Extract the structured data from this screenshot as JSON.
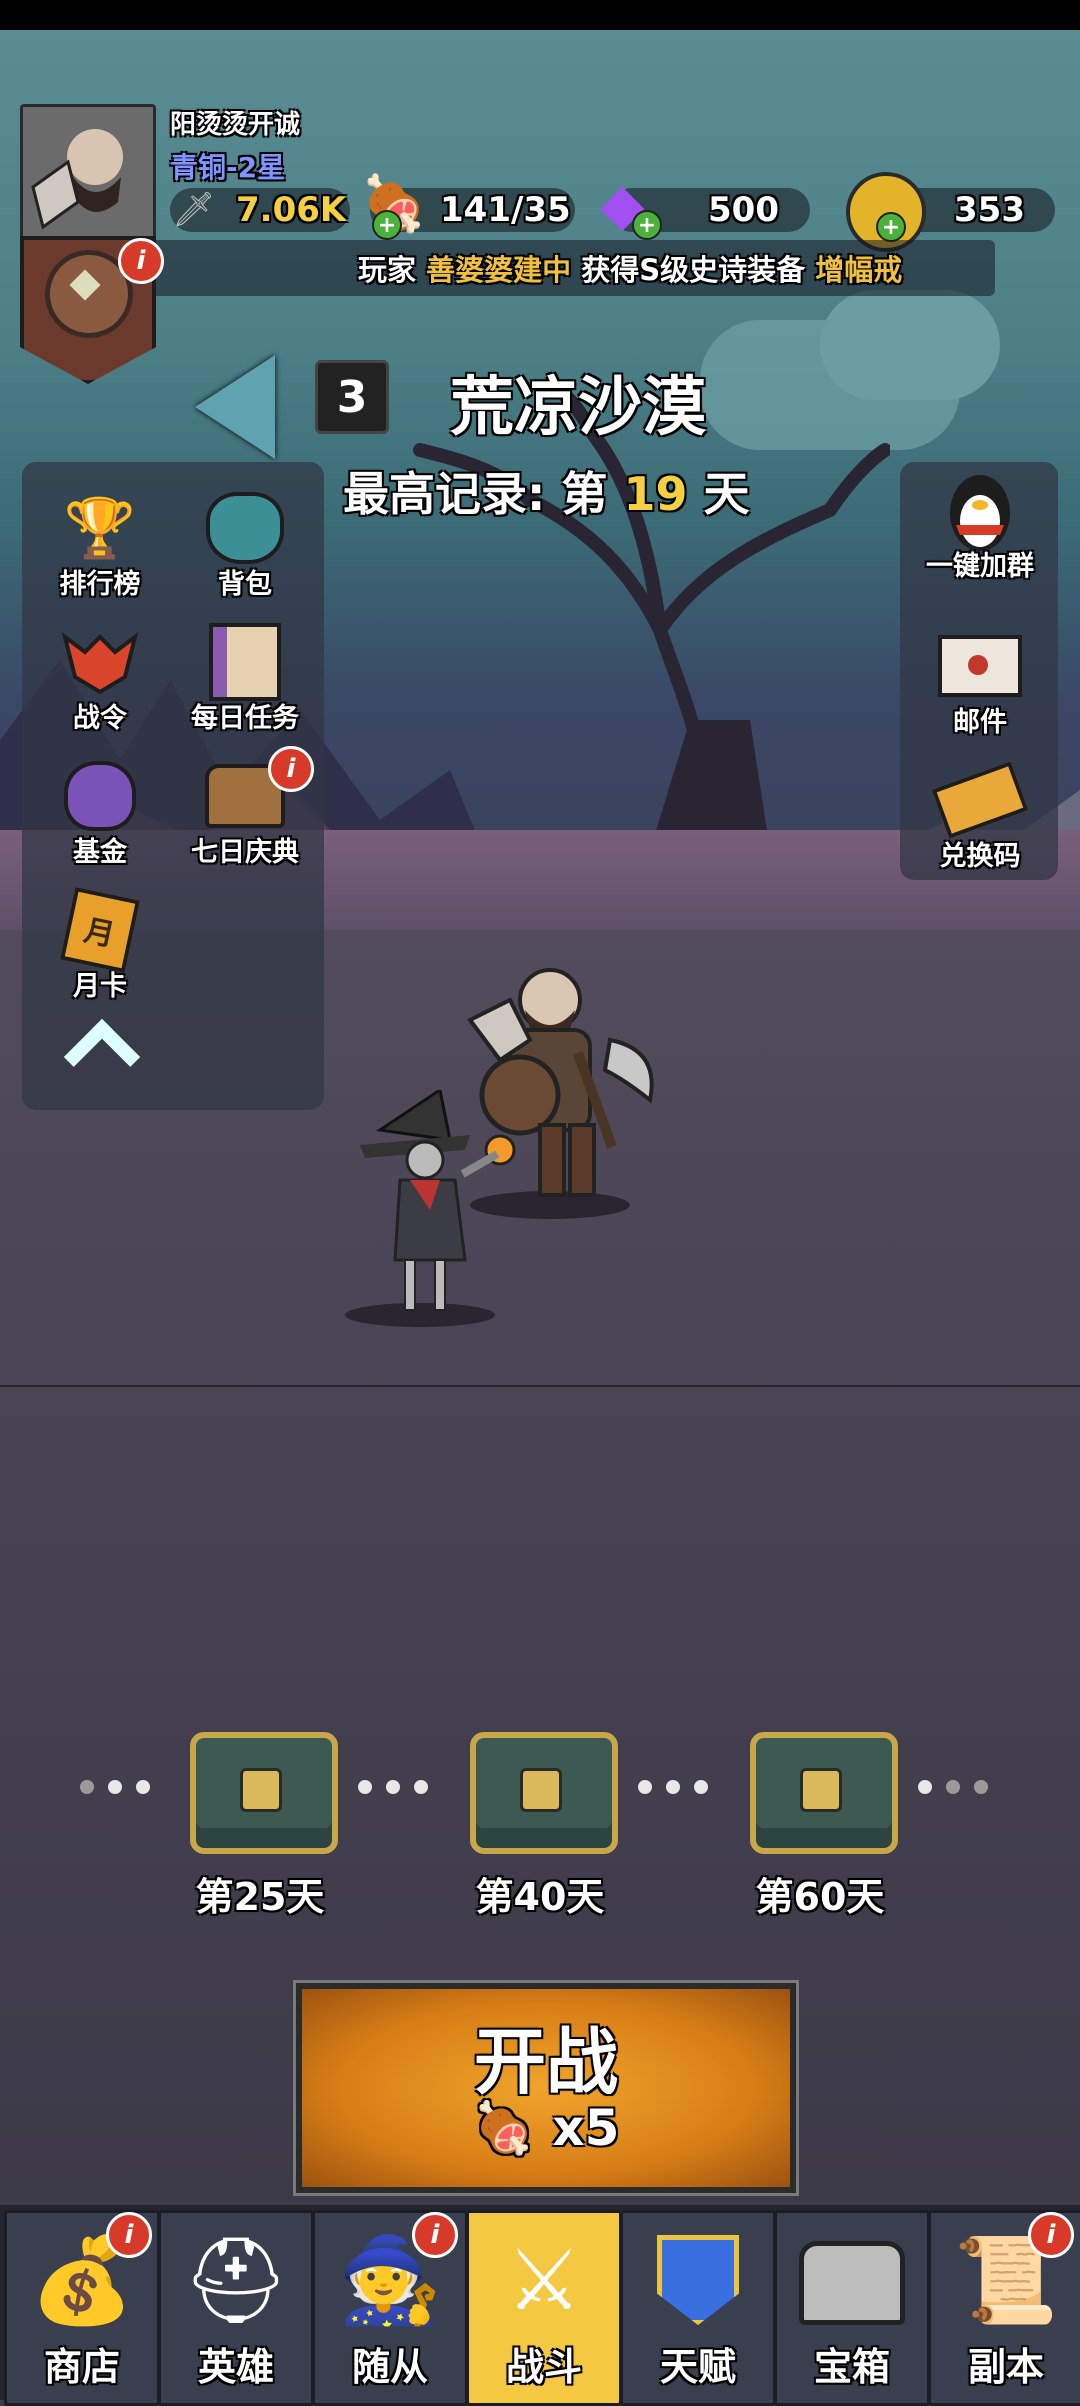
{
  "player": {
    "name": "阳烫烫开诚",
    "rank": "青铜-2星",
    "power": "7.06K"
  },
  "resources": {
    "stamina": "141/35",
    "gems": "500",
    "coins": "353"
  },
  "news": {
    "prefix": "玩家",
    "player": "善婆婆建中",
    "middle": "获得S级史诗装备",
    "item": "增幅戒"
  },
  "stage": {
    "number": "3",
    "name": "荒凉沙漠",
    "record_prefix": "最高记录:",
    "record_day_label": "第",
    "record_day": "19",
    "record_suffix": "天"
  },
  "left_menu": [
    {
      "label": "排行榜",
      "icon": "trophy-icon"
    },
    {
      "label": "背包",
      "icon": "bag-icon"
    },
    {
      "label": "战令",
      "icon": "demon-mask-icon"
    },
    {
      "label": "每日任务",
      "icon": "scroll-icon"
    },
    {
      "label": "基金",
      "icon": "money-bag-icon"
    },
    {
      "label": "七日庆典",
      "icon": "treasure-chest-icon"
    },
    {
      "label": "月卡",
      "icon": "month-card-icon"
    }
  ],
  "right_menu": [
    {
      "label": "一键加群",
      "icon": "penguin-icon"
    },
    {
      "label": "邮件",
      "icon": "envelope-icon"
    },
    {
      "label": "兑换码",
      "icon": "ticket-icon"
    }
  ],
  "milestones": [
    {
      "label": "第25天"
    },
    {
      "label": "第40天"
    },
    {
      "label": "第60天"
    }
  ],
  "fight_button": {
    "label": "开战",
    "cost": "x5"
  },
  "nav": [
    {
      "label": "商店",
      "icon": "shop-icon"
    },
    {
      "label": "英雄",
      "icon": "hero-helmet-icon"
    },
    {
      "label": "随从",
      "icon": "follower-icon"
    },
    {
      "label": "战斗",
      "icon": "battle-icon"
    },
    {
      "label": "天赋",
      "icon": "talent-icon"
    },
    {
      "label": "宝箱",
      "icon": "chest-icon"
    },
    {
      "label": "副本",
      "icon": "dungeon-map-icon"
    }
  ],
  "colors": {
    "accent_yellow": "#f5c842",
    "rank_blue": "#6a8cff",
    "news_highlight": "#f0c040",
    "badge_red": "#d83a2a"
  }
}
